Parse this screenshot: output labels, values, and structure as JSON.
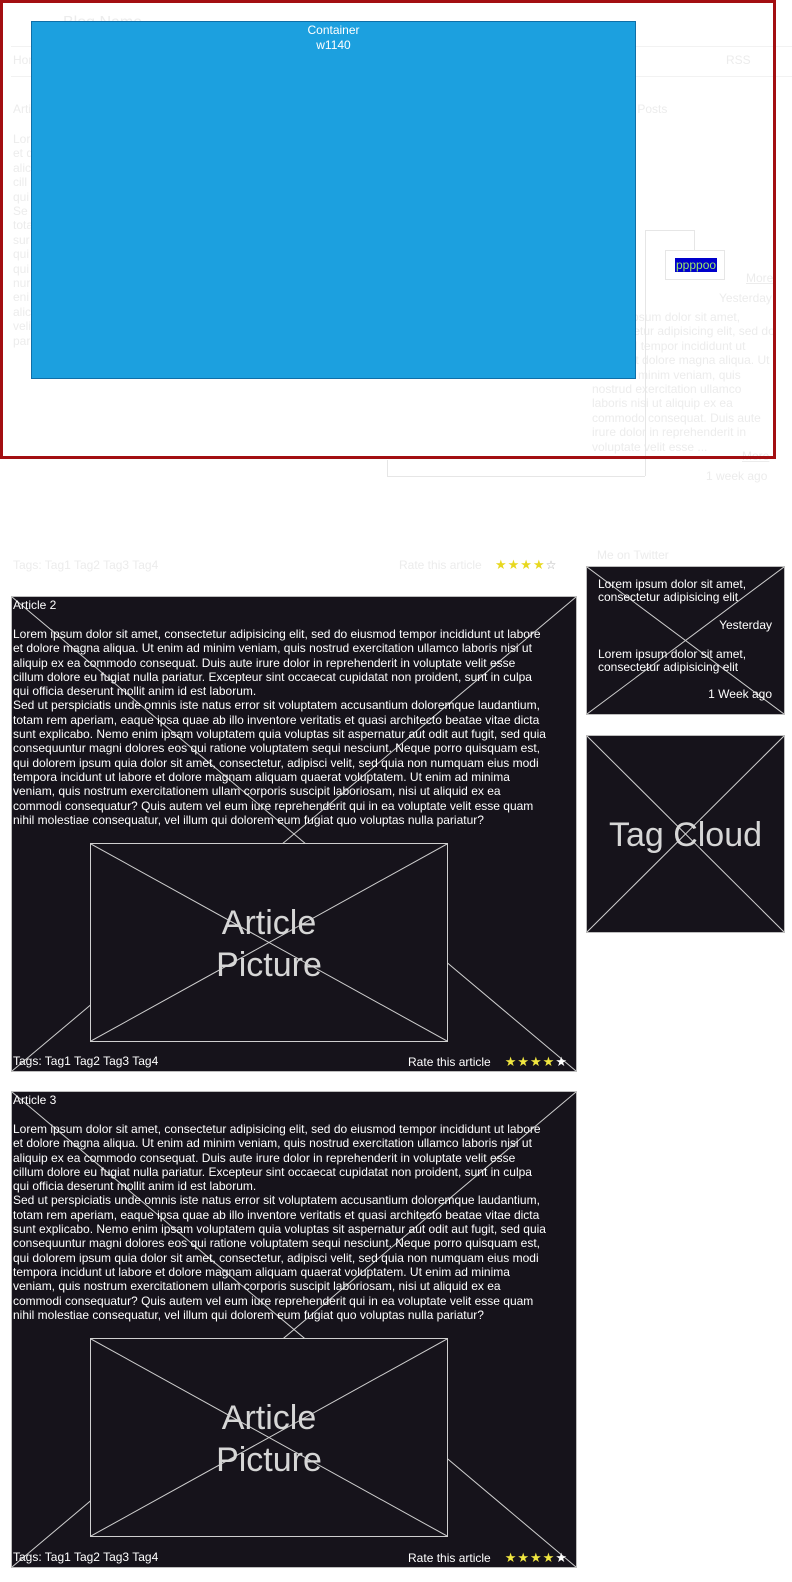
{
  "background_page": {
    "blog_name": "Blog Name",
    "nav_home": "Home",
    "nav_rss": "RSS",
    "article_heading": "Article 1",
    "posts_heading": "Recent Posts",
    "left_excerpt": "Lorem\net d\nalic\ncill\nqui\nSe\ntota\nsur\nqui\nqui\nnur\neni\nalic\nveli\npar",
    "right_excerpt": "Lorem ipsum dolor sit amet, consectetur adipisicing elit, sed do eiusmod tempor incididunt ut labore et dolore magna aliqua. Ut enim ad minim veniam, quis nostrud exercitation ullamco laboris nisi ut aliquip ex ea commodo consequat. Duis aute irure dolor in reprehenderit in voluptate velit esse ...",
    "more_1": "More",
    "yesterday": "Yesterday",
    "more_2": "More",
    "week_ago": "1 week ago",
    "tags": "Tags: Tag1 Tag2 Tag3 Tag4",
    "rate": "Rate this article",
    "twitter_heading": "Me on Twitter"
  },
  "overlay": {
    "title": "Container",
    "subtitle": "w1140",
    "label": "ppppoo",
    "frame_color": "#a30f12",
    "fill_color": "#1ca0df"
  },
  "articles": [
    {
      "title": "Article 2",
      "picture": "Article Picture",
      "tags": "Tags: Tag1 Tag2 Tag3 Tag4",
      "rate": "Rate this article",
      "rating": 4
    },
    {
      "title": "Article 3",
      "picture": "Article Picture",
      "tags": "Tags: Tag1 Tag2 Tag3 Tag4",
      "rate": "Rate this article",
      "rating": 4
    }
  ],
  "article_body": "Lorem ipsum dolor sit amet, consectetur adipisicing elit, sed do eiusmod tempor incididunt ut labore et dolore magna aliqua. Ut enim ad minim veniam, quis nostrud exercitation ullamco laboris nisi ut aliquip ex ea commodo consequat. Duis aute irure dolor in reprehenderit in voluptate velit esse cillum dolore eu fugiat nulla pariatur. Excepteur sint occaecat cupidatat non proident, sunt in culpa qui officia deserunt mollit anim id est laborum.\nSed ut perspiciatis unde omnis iste natus error sit voluptatem accusantium doloremque laudantium, totam rem aperiam, eaque ipsa quae ab illo inventore veritatis et quasi architecto beatae vitae dicta sunt explicabo. Nemo enim ipsam voluptatem quia voluptas sit aspernatur aut odit aut fugit, sed quia consequuntur magni dolores eos qui ratione voluptatem sequi nesciunt. Neque porro quisquam est, qui dolorem ipsum quia dolor sit amet, consectetur, adipisci velit, sed quia non numquam eius modi tempora incidunt ut labore et dolore magnam aliquam quaerat voluptatem. Ut enim ad minima veniam, quis nostrum exercitationem ullam corporis suscipit laboriosam, nisi ut aliquid ex ea commodi consequatur? Quis autem vel eum iure reprehenderit qui in ea voluptate velit esse quam nihil molestiae consequatur, vel illum qui dolorem eum fugiat quo voluptas nulla pariatur?",
  "twitter": {
    "tweets": [
      {
        "text": "Lorem ipsum dolor sit amet, consectetur adipisicing elit",
        "time": "Yesterday"
      },
      {
        "text": "Lorem ipsum dolor sit amet, consectetur adipisicing elit",
        "time": "1 Week ago"
      }
    ]
  },
  "tag_cloud": {
    "label": "Tag Cloud"
  }
}
